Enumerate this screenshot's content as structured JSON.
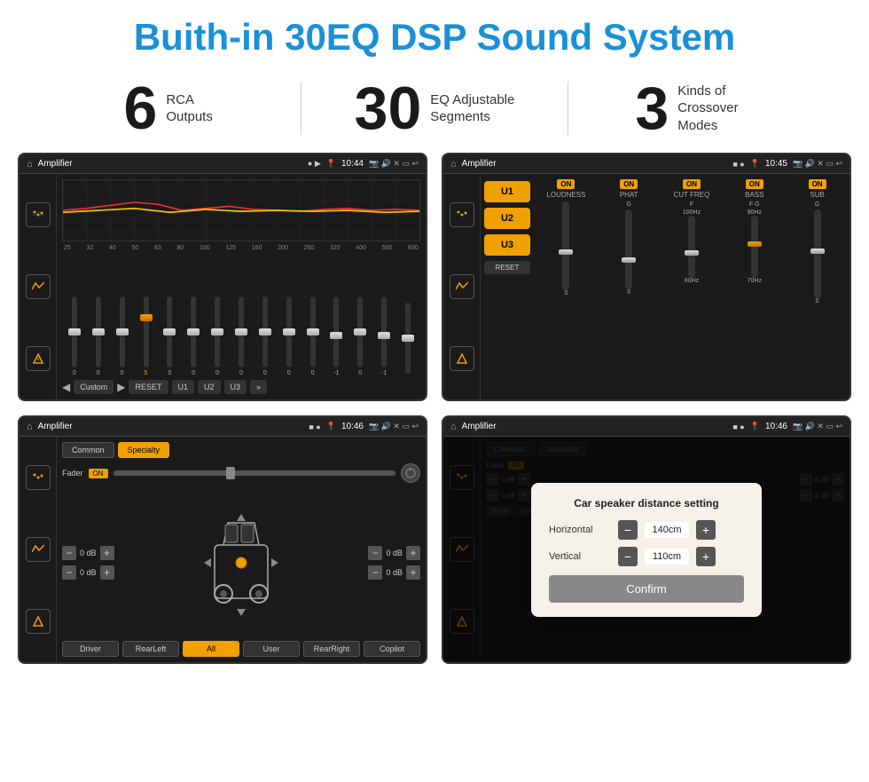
{
  "header": {
    "title": "Buith-in 30EQ DSP Sound System"
  },
  "stats": [
    {
      "num": "6",
      "label": "RCA\nOutputs"
    },
    {
      "num": "30",
      "label": "EQ Adjustable\nSegments"
    },
    {
      "num": "3",
      "label": "Kinds of\nCrossover Modes"
    }
  ],
  "screen1": {
    "status": {
      "title": "Amplifier",
      "time": "10:44"
    },
    "eq_bands": [
      "25",
      "32",
      "40",
      "50",
      "63",
      "80",
      "100",
      "125",
      "160",
      "200",
      "250",
      "320",
      "400",
      "500",
      "630"
    ],
    "eq_values": [
      "0",
      "0",
      "0",
      "5",
      "0",
      "0",
      "0",
      "0",
      "0",
      "0",
      "0",
      "-1",
      "0",
      "-1",
      ""
    ],
    "preset": "Custom",
    "buttons": [
      "RESET",
      "U1",
      "U2",
      "U3"
    ]
  },
  "screen2": {
    "status": {
      "title": "Amplifier",
      "time": "10:45"
    },
    "sections": [
      "LOUDNESS",
      "PHAT",
      "CUT FREQ",
      "BASS",
      "SUB"
    ],
    "presets": [
      "U1",
      "U2",
      "U3"
    ]
  },
  "screen3": {
    "status": {
      "title": "Amplifier",
      "time": "10:46"
    },
    "tabs": [
      "Common",
      "Specialty"
    ],
    "active_tab": "Specialty",
    "fader_label": "Fader",
    "fader_on": "ON",
    "controls_left": [
      "0 dB",
      "0 dB"
    ],
    "controls_right": [
      "0 dB",
      "0 dB"
    ],
    "bottom_buttons": [
      "Driver",
      "RearLeft",
      "All",
      "User",
      "RearRight",
      "Copilot"
    ]
  },
  "screen4": {
    "status": {
      "title": "Amplifier",
      "time": "10:46"
    },
    "tabs": [
      "Common",
      "Specialty"
    ],
    "dialog": {
      "title": "Car speaker distance setting",
      "horizontal_label": "Horizontal",
      "horizontal_value": "140cm",
      "vertical_label": "Vertical",
      "vertical_value": "110cm",
      "confirm_label": "Confirm"
    },
    "controls_right": [
      "0 dB",
      "0 dB"
    ],
    "bottom_buttons": [
      "Driver",
      "RearLeft",
      "All",
      "User",
      "RearRight",
      "Copilot"
    ]
  }
}
